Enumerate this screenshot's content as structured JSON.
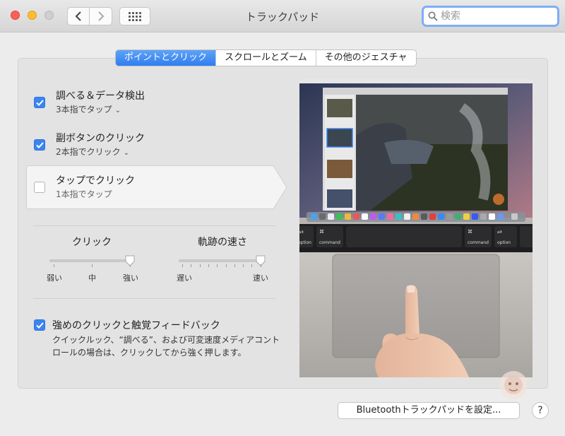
{
  "window": {
    "title": "トラックパッド",
    "search_placeholder": "検索"
  },
  "tabs": [
    {
      "label": "ポイントとクリック",
      "active": true
    },
    {
      "label": "スクロールとズーム",
      "active": false
    },
    {
      "label": "その他のジェスチャ",
      "active": false
    }
  ],
  "options": [
    {
      "title": "調べる＆データ検出",
      "subtitle": "3本指でタップ",
      "checked": true,
      "has_menu": true
    },
    {
      "title": "副ボタンのクリック",
      "subtitle": "2本指でクリック",
      "checked": true,
      "has_menu": true
    },
    {
      "title": "タップでクリック",
      "subtitle": "1本指でタップ",
      "checked": false,
      "has_menu": false
    }
  ],
  "sliders": {
    "click": {
      "label": "クリック",
      "min_label": "弱い",
      "mid_label": "中",
      "max_label": "強い",
      "value": 1.0
    },
    "speed": {
      "label": "軌跡の速さ",
      "min_label": "遅い",
      "max_label": "速い",
      "value": 1.0
    }
  },
  "force_touch": {
    "label": "強めのクリックと触覚フィードバック",
    "checked": true,
    "description": "クイックルック、“調べる”、および可変速度メディアコントロールの場合は、クリックしてから強く押します。"
  },
  "preview": {
    "keys": {
      "alt": "alt",
      "option": "option",
      "command": "command",
      "cmd_symbol": "⌘"
    }
  },
  "buttons": {
    "bluetooth": "Bluetoothトラックパッドを設定...",
    "help": "?"
  },
  "colors": {
    "accent": "#3a85f1",
    "background": "#ececec"
  }
}
